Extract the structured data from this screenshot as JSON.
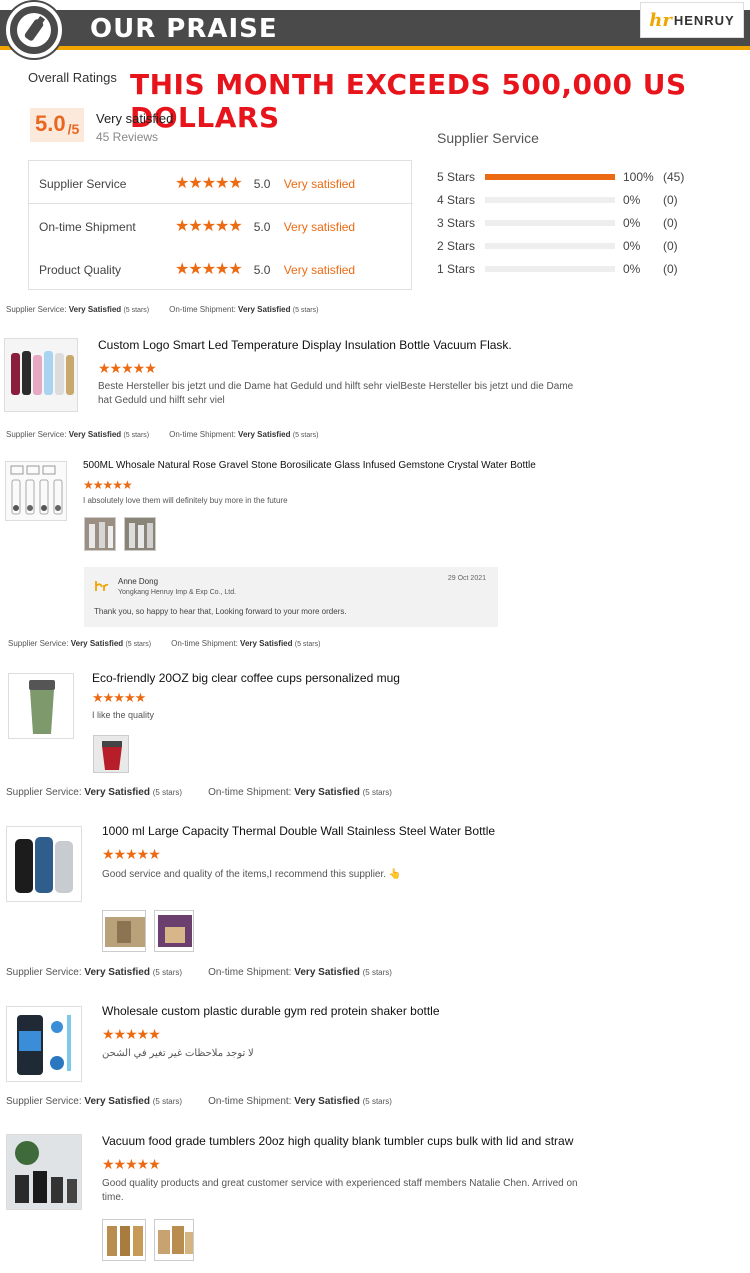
{
  "header": {
    "title": "OUR PRAISE",
    "brand_mark": "hr",
    "brand_name": "HENRUY",
    "badge_icon": "bottle-icon"
  },
  "ratings": {
    "overall_label": "Overall Ratings",
    "headline": "THIS MONTH EXCEEDS 500,000 US DOLLARS",
    "score": "5.0",
    "score_suffix": "/5",
    "score_title": "Very satisfied",
    "reviews_count": "45 Reviews",
    "rows": [
      {
        "label": "Supplier Service",
        "stars": "★★★★★",
        "value": "5.0",
        "text": "Very satisfied"
      },
      {
        "label": "On-time Shipment",
        "stars": "★★★★★",
        "value": "5.0",
        "text": "Very satisfied"
      },
      {
        "label": "Product Quality",
        "stars": "★★★★★",
        "value": "5.0",
        "text": "Very satisfied"
      }
    ],
    "supplier_service_title": "Supplier Service",
    "distribution": [
      {
        "label": "5  Stars",
        "fraction": 1.0,
        "pct": "100%",
        "count": "(45)"
      },
      {
        "label": "4  Stars",
        "fraction": 0.0,
        "pct": "0%",
        "count": "(0)"
      },
      {
        "label": "3  Stars",
        "fraction": 0.0,
        "pct": "0%",
        "count": "(0)"
      },
      {
        "label": "2  Stars",
        "fraction": 0.0,
        "pct": "0%",
        "count": "(0)"
      },
      {
        "label": "1  Stars",
        "fraction": 0.0,
        "pct": "0%",
        "count": "(0)"
      }
    ],
    "accent_color": "#ec6a12"
  },
  "summary": {
    "service_label": "Supplier Service:",
    "shipment_label": "On-time Shipment:",
    "value": "Very Satisfied",
    "stars_note": "(5 stars)"
  },
  "reviews": [
    {
      "title": "Custom Logo Smart Led Temperature Display Insulation Bottle  Vacuum Flask.",
      "stars": "★★★★★",
      "body": "Beste Hersteller bis jetzt und die Dame hat Geduld und hilft sehr vielBeste Hersteller bis jetzt und die Dame hat Geduld und hilft sehr viel"
    },
    {
      "title": "500ML Whosale Natural Rose Gravel Stone Borosilicate Glass Infused Gemstone Crystal Water Bottle",
      "stars": "★★★★★",
      "body": "I absolutely love them will definitely buy more in the future",
      "reply": {
        "name": "Anne Dong",
        "company": "Yongkang Henruy Imp & Exp Co., Ltd.",
        "date": "29 Oct 2021",
        "text": "Thank you, so happy to hear that, Looking forward to your more orders."
      }
    },
    {
      "title": "Eco-friendly 20OZ big clear coffee cups personalized mug",
      "stars": "★★★★★",
      "body": "I like the quality"
    },
    {
      "title": "1000 ml Large Capacity Thermal Double Wall Stainless Steel Water Bottle",
      "stars": "★★★★★",
      "body": "Good service and quality of the items,I recommend this supplier. 👆"
    },
    {
      "title": "Wholesale custom plastic durable gym red protein shaker bottle",
      "stars": "★★★★★",
      "body": "لا توجد ملاحظات غير تغير في الشحن"
    },
    {
      "title": "Vacuum food grade tumblers 20oz high quality blank tumbler cups bulk with lid and straw",
      "stars": "★★★★★",
      "body": "Good quality products and great customer service with experienced staff members Natalie Chen. Arrived on time."
    }
  ]
}
